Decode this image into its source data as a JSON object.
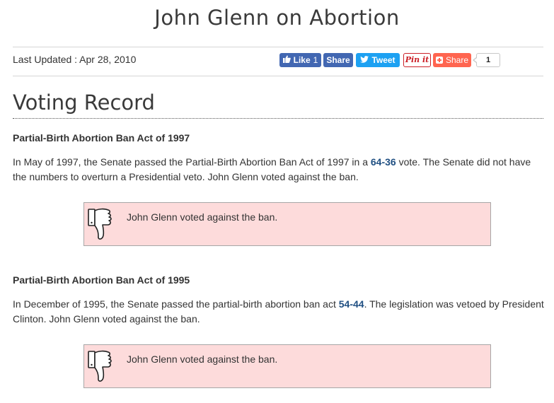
{
  "page": {
    "title": "John Glenn on Abortion",
    "last_updated_label": "Last Updated : Apr 28, 2010"
  },
  "share_bar": {
    "like_label": "Like",
    "like_count": "1",
    "fb_share_label": "Share",
    "tweet_label": "Tweet",
    "pin_label": "Pin it",
    "add_share_label": "Share",
    "share_count": "1",
    "colors": {
      "facebook": "#4267b2",
      "twitter": "#1da1f2",
      "pinterest": "#cb2027",
      "addthis": "#ff6550"
    }
  },
  "section": {
    "heading": "Voting Record"
  },
  "bills": [
    {
      "title": "Partial-Birth Abortion Ban Act of 1997",
      "text_before": "In May of 1997, the Senate passed the Partial-Birth Abortion Ban Act of 1997 in a ",
      "vote": "64-36",
      "text_after": " vote. The Senate did not have the numbers to overturn a Presidential veto. John Glenn voted against the ban.",
      "vote_box_text": "John Glenn voted against the ban.",
      "vote_icon": "thumbs-down-icon"
    },
    {
      "title": "Partial-Birth Abortion Ban Act of 1995",
      "text_before": "In December of 1995, the Senate passed the partial-birth abortion ban act ",
      "vote": "54-44",
      "text_after": ". The legislation was vetoed by President Clinton. John Glenn voted against the ban.",
      "vote_box_text": "John Glenn voted against the ban.",
      "vote_icon": "thumbs-down-icon"
    }
  ],
  "colors": {
    "vote_box_bg": "#fddbdb",
    "link": "#1f4f82"
  }
}
